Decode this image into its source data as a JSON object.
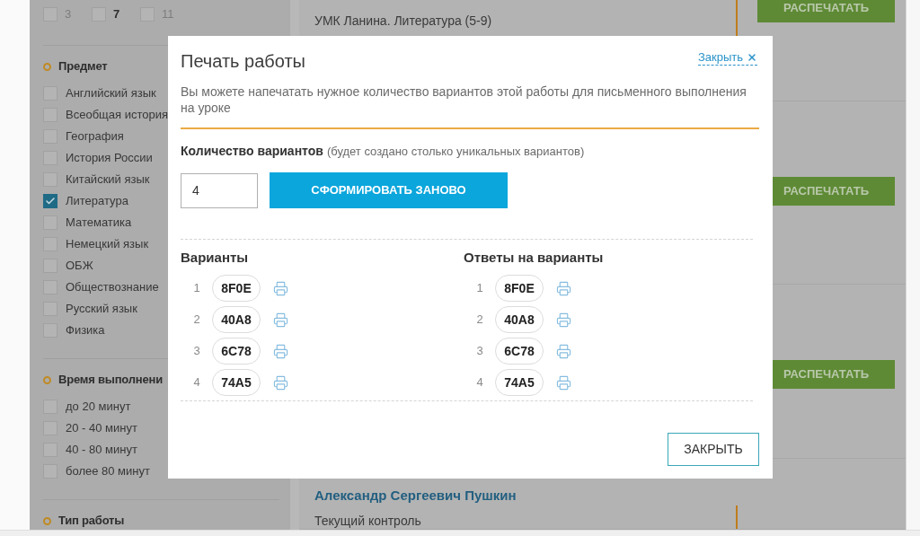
{
  "sidebar": {
    "grades": [
      {
        "label": "3",
        "checked": false,
        "disabled": true
      },
      {
        "label": "7",
        "checked": false,
        "disabled": false
      },
      {
        "label": "11",
        "checked": false,
        "disabled": true
      }
    ],
    "sections": [
      {
        "title": "Предмет",
        "items": [
          {
            "label": "Английский язык",
            "checked": false
          },
          {
            "label": "Всеобщая история",
            "checked": false
          },
          {
            "label": "География",
            "checked": false
          },
          {
            "label": "История России",
            "checked": false
          },
          {
            "label": "Китайский язык",
            "checked": false
          },
          {
            "label": "Литература",
            "checked": true
          },
          {
            "label": "Математика",
            "checked": false
          },
          {
            "label": "Немецкий язык",
            "checked": false
          },
          {
            "label": "ОБЖ",
            "checked": false
          },
          {
            "label": "Обществознание",
            "checked": false
          },
          {
            "label": "Русский язык",
            "checked": false
          },
          {
            "label": "Физика",
            "checked": false
          }
        ]
      },
      {
        "title": "Время выполнени",
        "items": [
          {
            "label": "до 20 минут",
            "checked": false
          },
          {
            "label": "20 - 40 минут",
            "checked": false
          },
          {
            "label": "40 - 80 минут",
            "checked": false
          },
          {
            "label": "более 80 минут",
            "checked": false
          }
        ]
      },
      {
        "title": "Тип работы"
      }
    ]
  },
  "results": [
    {
      "lines": [
        "УМК Ланина. Литература (5-9)"
      ],
      "button": "РАСПЕЧАТАТЬ"
    },
    {
      "button": "РАСПЕЧАТАТЬ"
    },
    {
      "button": "РАСПЕЧАТАТЬ"
    },
    {
      "author": "Александр Сергеевич Пушкин",
      "lines": [
        "Текущий контроль"
      ]
    }
  ],
  "dialog": {
    "title": "Печать работы",
    "close_link": "Закрыть",
    "description": "Вы можете напечатать нужное количество вариантов этой работы для письменного выполнения на уроке",
    "count_label": "Количество вариантов",
    "count_hint": "(будет создано столько уникальных вариантов)",
    "count_value": "4",
    "regenerate_button": "СФОРМИРОВАТЬ ЗАНОВО",
    "columns": [
      {
        "title": "Варианты",
        "rows": [
          {
            "number": "1",
            "code": "8F0E"
          },
          {
            "number": "2",
            "code": "40A8"
          },
          {
            "number": "3",
            "code": "6C78"
          },
          {
            "number": "4",
            "code": "74A5"
          }
        ]
      },
      {
        "title": "Ответы на варианты",
        "rows": [
          {
            "number": "1",
            "code": "8F0E"
          },
          {
            "number": "2",
            "code": "40A8"
          },
          {
            "number": "3",
            "code": "6C78"
          },
          {
            "number": "4",
            "code": "74A5"
          }
        ]
      }
    ],
    "close_button": "ЗАКРЫТЬ"
  }
}
